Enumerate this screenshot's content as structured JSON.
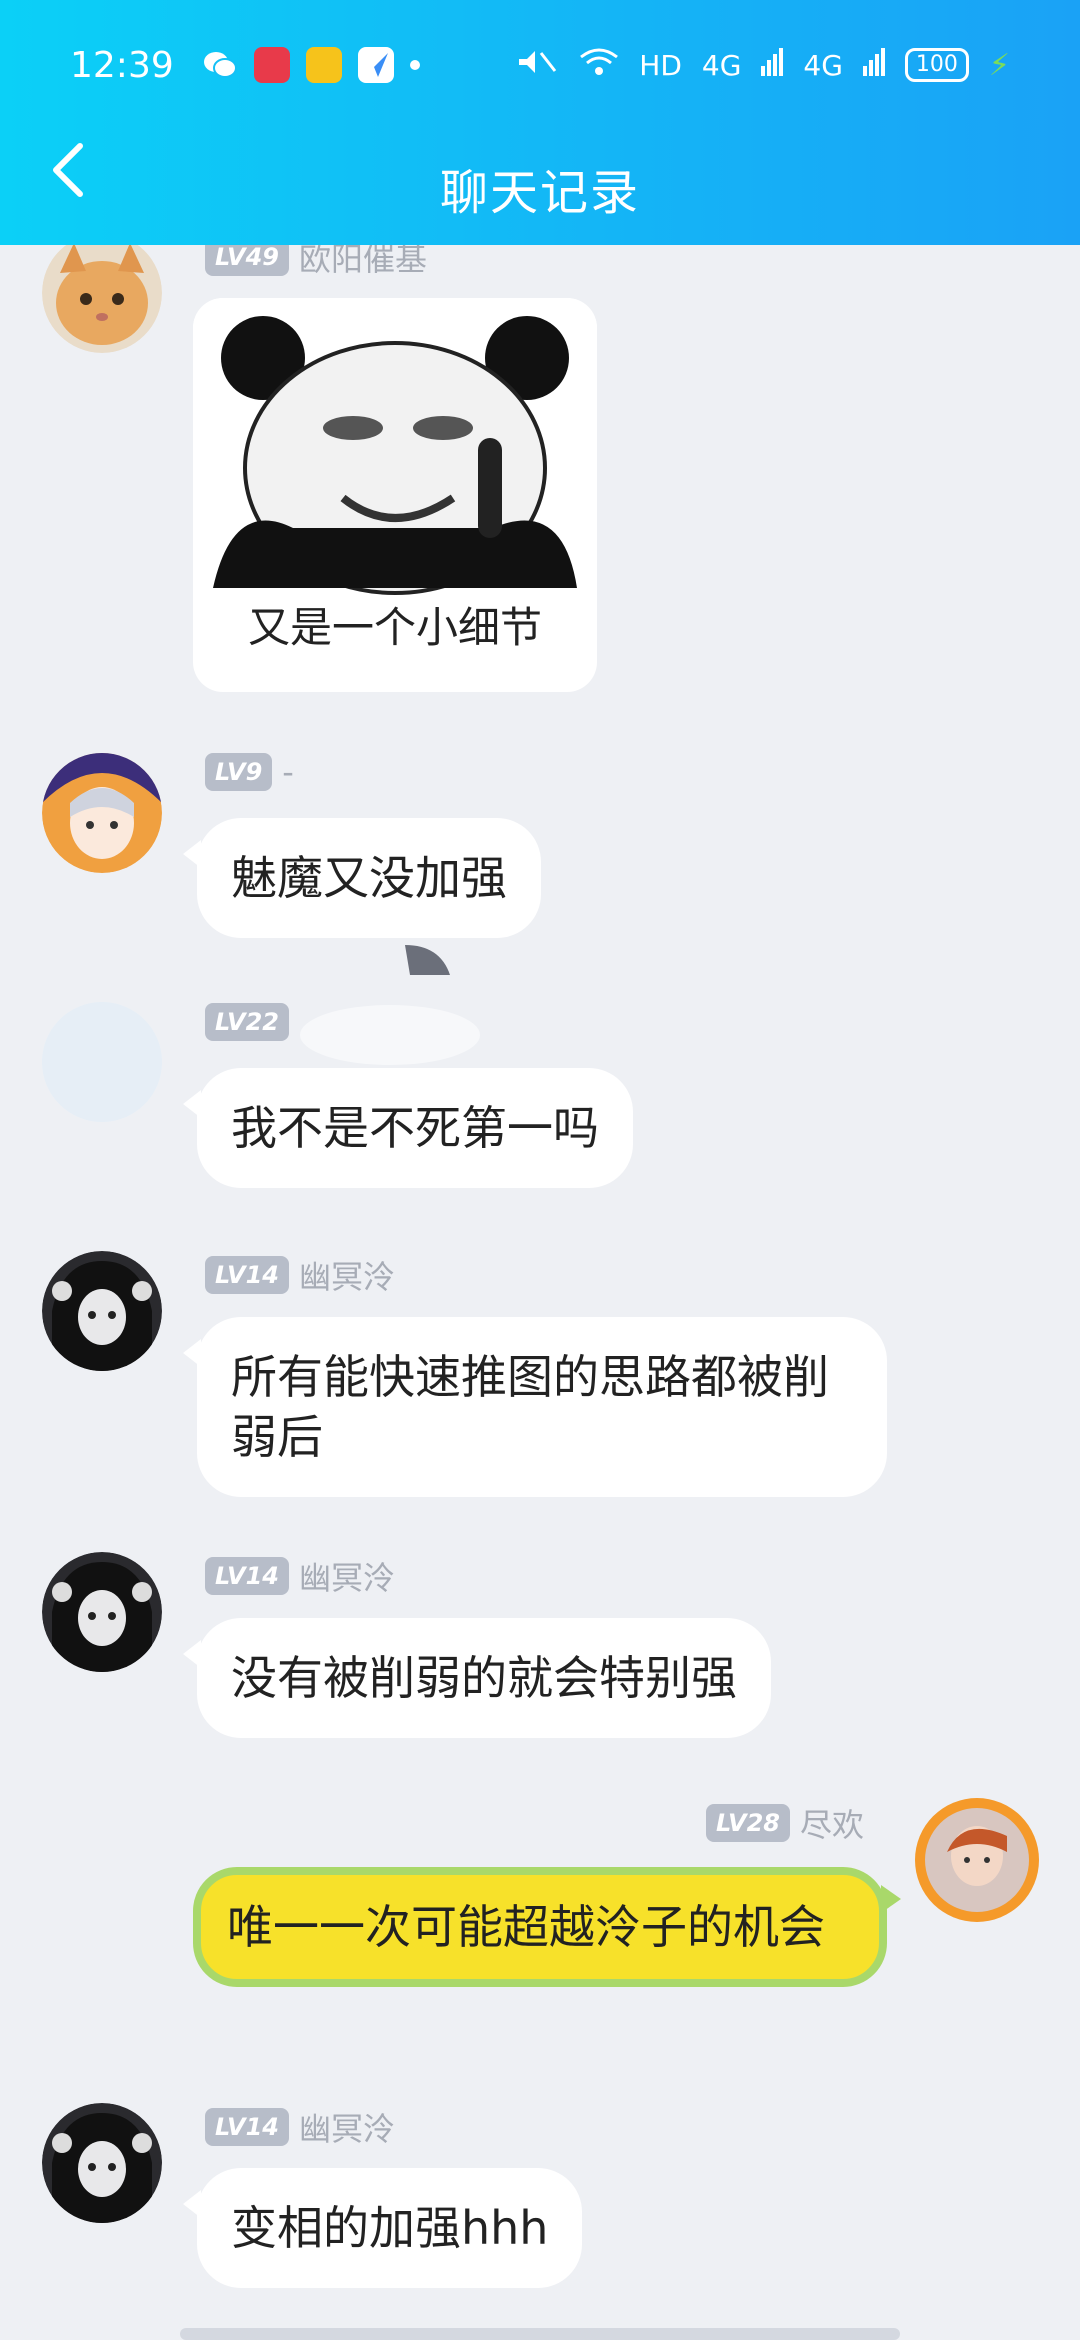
{
  "status": {
    "time": "12:39",
    "network": "HD",
    "signal1": "4G",
    "signal2": "4G",
    "battery": "100"
  },
  "header": {
    "title": "聊天记录"
  },
  "colors": {
    "header_gradient": [
      "#0bd0f7",
      "#1aa2f6"
    ],
    "bubble_other": "#ffffff",
    "bubble_mine": "#f7e12a",
    "bubble_mine_border": "#a9d86a",
    "level_badge": "#b7bdc9"
  },
  "messages": [
    {
      "level": "LV49",
      "nick": "欧阳催基",
      "type": "sticker",
      "caption": "又是一个小细节",
      "avatar": "orange-cat-avatar"
    },
    {
      "level": "LV9",
      "nick": "-",
      "type": "text",
      "text": "魅魔又没加强",
      "avatar": "anime-witch-avatar"
    },
    {
      "level": "LV22",
      "nick": "",
      "type": "text",
      "text": "我不是不死第一吗",
      "avatar": "faded-avatar"
    },
    {
      "level": "LV14",
      "nick": "幽冥泠",
      "type": "text",
      "text": "所有能快速推图的思路都被削弱后",
      "avatar": "dark-anime-girl-avatar"
    },
    {
      "level": "LV14",
      "nick": "幽冥泠",
      "type": "text",
      "text": "没有被削弱的就会特别强",
      "avatar": "dark-anime-girl-avatar"
    },
    {
      "level": "LV28",
      "nick": "尽欢",
      "type": "text",
      "text": "唯一一次可能超越泠子的机会",
      "mine": true,
      "avatar": "fire-frame-avatar"
    },
    {
      "level": "LV14",
      "nick": "幽冥泠",
      "type": "text",
      "text": "变相的加强hhh",
      "avatar": "dark-anime-girl-avatar"
    }
  ]
}
